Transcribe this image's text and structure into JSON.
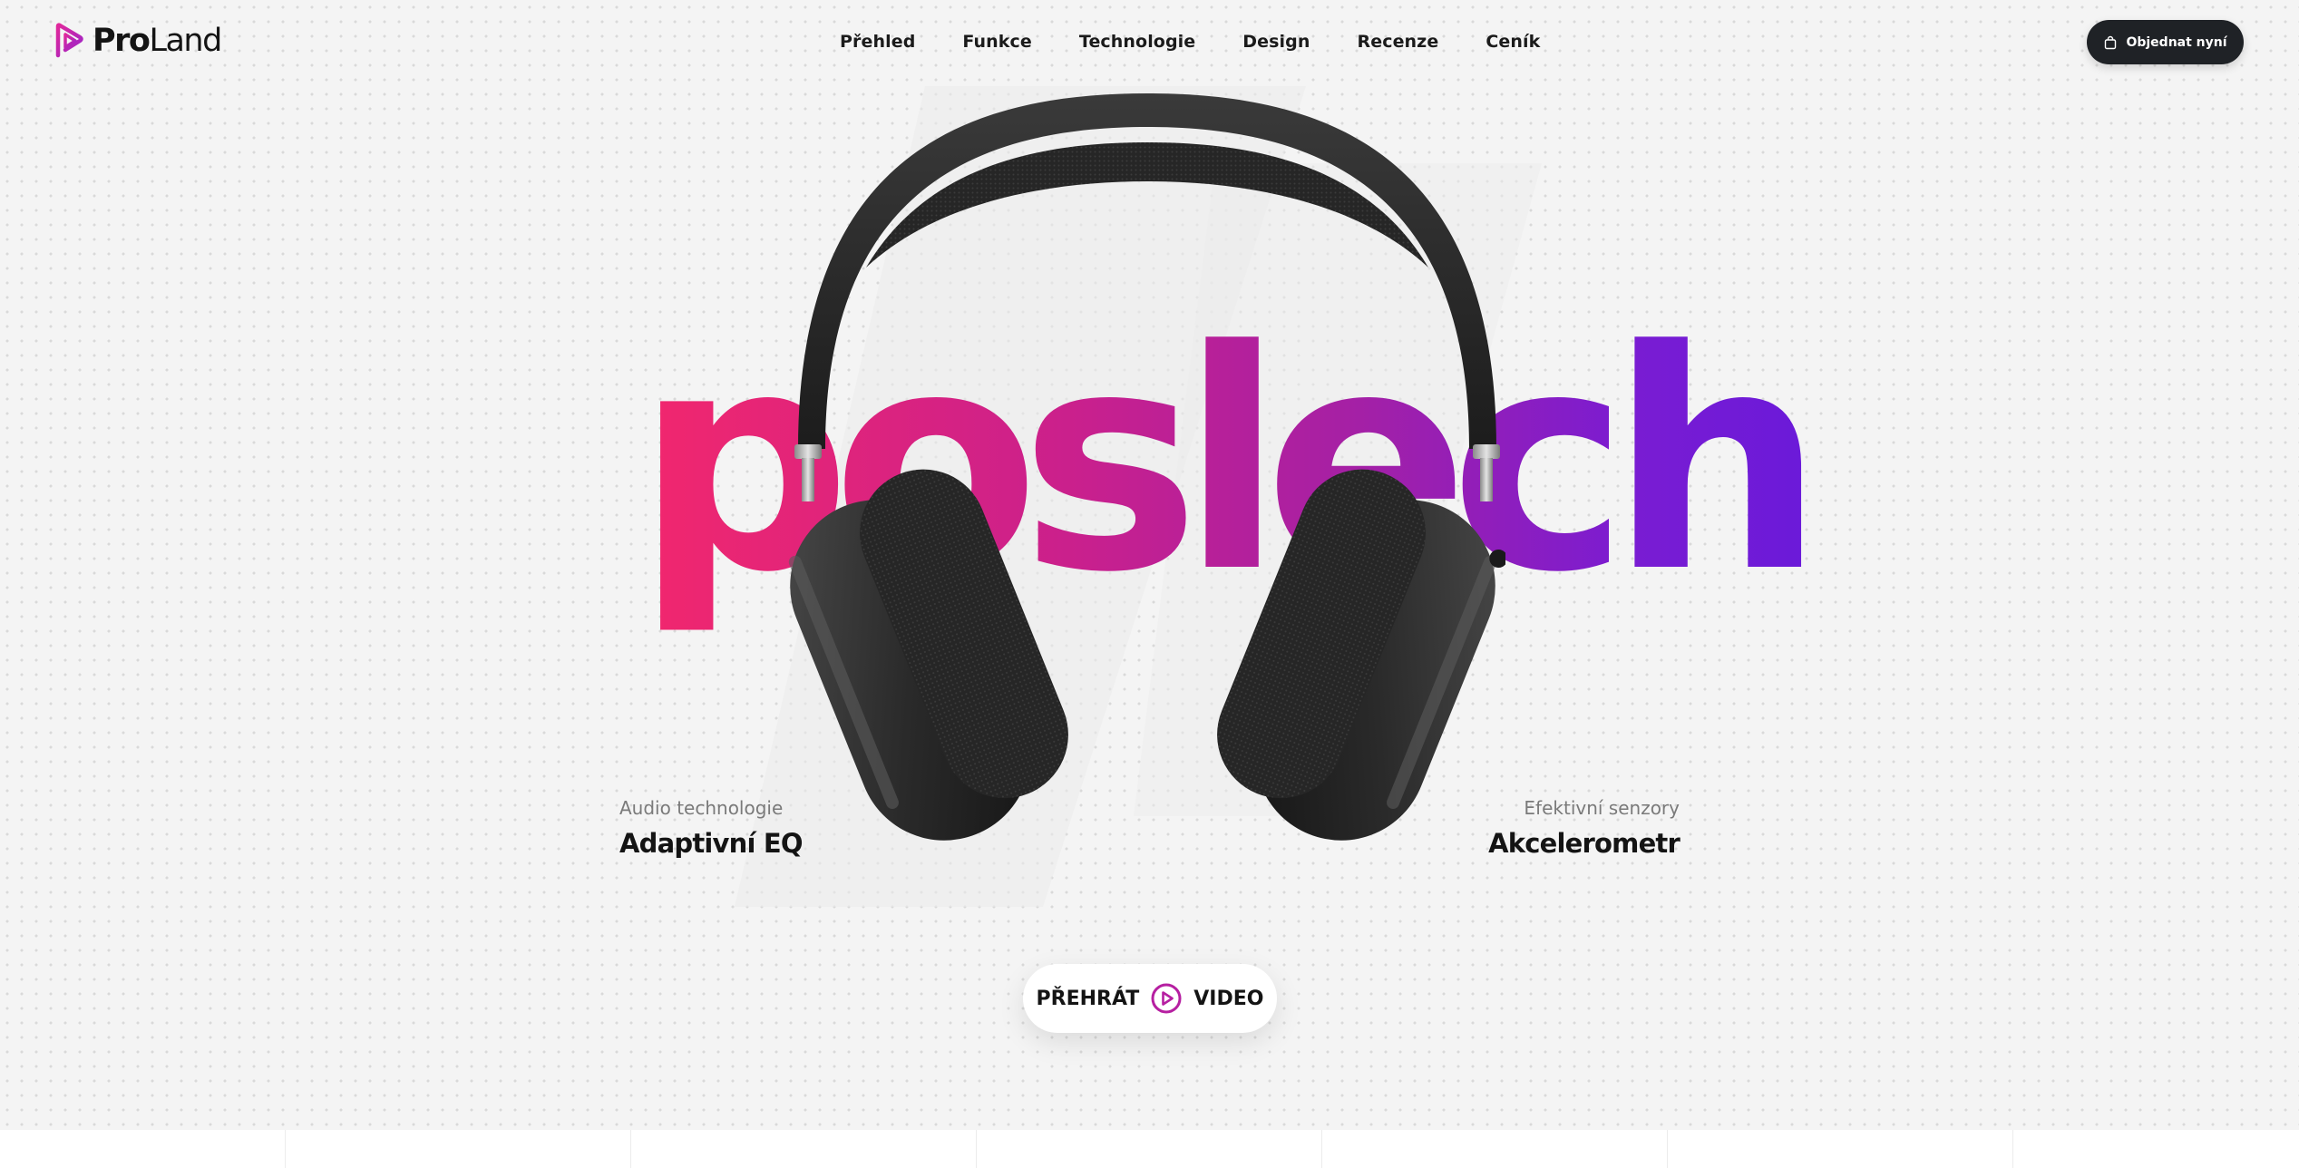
{
  "brand": {
    "name_bold": "Pro",
    "name_light": "Land",
    "accent": "#c21fa0"
  },
  "nav": {
    "items": [
      {
        "label": "Přehled"
      },
      {
        "label": "Funkce"
      },
      {
        "label": "Technologie"
      },
      {
        "label": "Design"
      },
      {
        "label": "Recenze"
      },
      {
        "label": "Ceník"
      }
    ]
  },
  "order_button": {
    "label": "Objednat nyní",
    "icon": "shopping-bag-icon"
  },
  "hero": {
    "word": "poslech",
    "gradient": [
      "#f2276d",
      "#c9208d",
      "#a420a6",
      "#7a1cd2",
      "#6b1ad9"
    ]
  },
  "features": {
    "left": {
      "caption": "Audio technologie",
      "title": "Adaptivní EQ"
    },
    "right": {
      "caption": "Efektivní senzory",
      "title": "Akcelerometr"
    }
  },
  "video_button": {
    "label_before": "PŘEHRÁT",
    "label_after": "VIDEO",
    "icon": "play-circle-icon"
  }
}
